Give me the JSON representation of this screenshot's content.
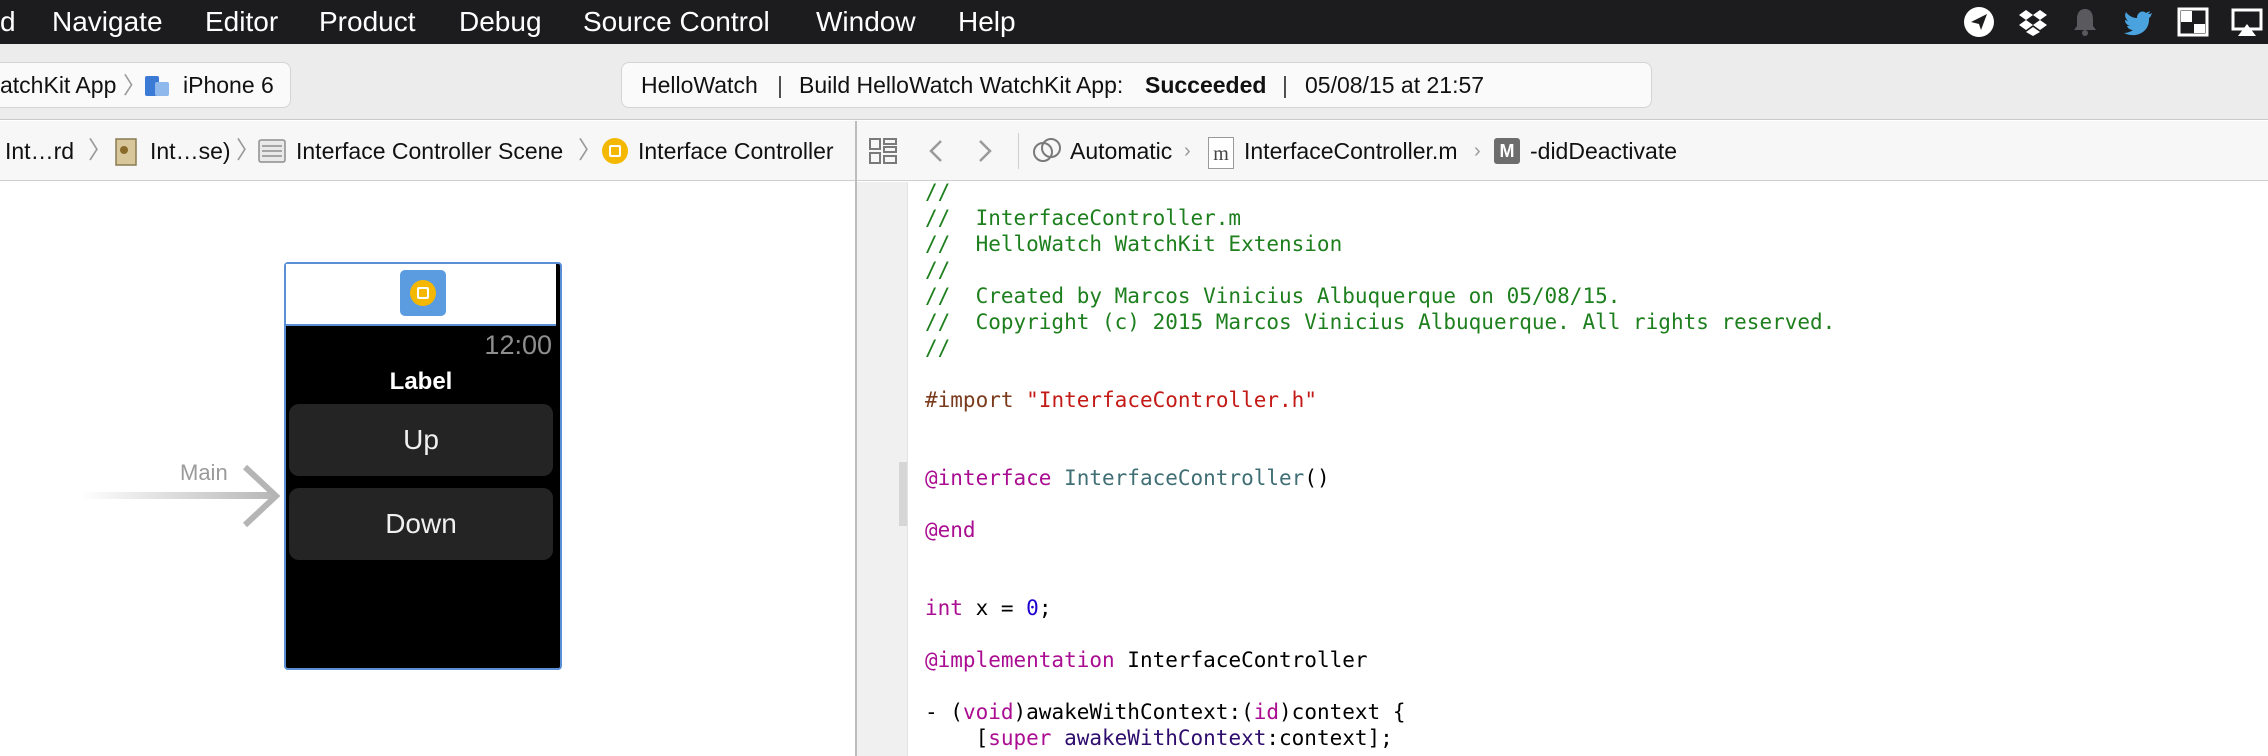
{
  "menubar": {
    "items": [
      "d",
      "Navigate",
      "Editor",
      "Product",
      "Debug",
      "Source Control",
      "Window",
      "Help"
    ],
    "tray_icons": [
      "send-icon",
      "dropbox-icon",
      "bell-icon",
      "twitter-icon",
      "window-icon",
      "airplay-icon"
    ]
  },
  "toolbar": {
    "scheme": "atchKit App",
    "device": "iPhone 6",
    "status": {
      "project": "HelloWatch",
      "build_prefix": "Build HelloWatch WatchKit App:",
      "result": "Succeeded",
      "timestamp": "05/08/15 at 21:57"
    }
  },
  "jumpbar_left": {
    "items": [
      "Int…rd",
      "Int…se)",
      "Interface Controller Scene",
      "Interface Controller"
    ]
  },
  "jumpbar_right": {
    "mode": "Automatic",
    "file": "InterfaceController.m",
    "method": "-didDeactivate",
    "file_icon_letter": "m",
    "method_icon_letter": "M"
  },
  "canvas": {
    "entry_label": "Main",
    "watch": {
      "time": "12:00",
      "label": "Label",
      "buttons": [
        "Up",
        "Down"
      ]
    }
  },
  "editor": {
    "comments": [
      "//",
      "//  InterfaceController.m",
      "//  HelloWatch WatchKit Extension",
      "//",
      "//  Created by Marcos Vinicius Albuquerque on 05/08/15.",
      "//  Copyright (c) 2015 Marcos Vinicius Albuquerque. All rights reserved.",
      "//"
    ],
    "import_directive": "#import",
    "import_file": "\"InterfaceController.h\"",
    "interface_kw": "@interface",
    "class_name": "InterfaceController",
    "parens": "()",
    "end_kw": "@end",
    "int_kw": "int",
    "var_decl": " x = ",
    "zero": "0",
    "semicolon": ";",
    "implementation_kw": "@implementation",
    "impl_class": " InterfaceController",
    "method_prefix": "- (",
    "void_kw": "void",
    "method_name": ")awakeWithContext:(",
    "id_kw": "id",
    "method_suffix": ")context {",
    "super_open": "    [",
    "super_kw": "super",
    "super_call": " awakeWithContext",
    "super_args": ":context];"
  },
  "colors": {
    "accent_blue": "#5a8fd6",
    "comment": "#1d7f1d",
    "keyword": "#aa0d91",
    "string": "#c41a16",
    "number": "#1c00cf"
  }
}
